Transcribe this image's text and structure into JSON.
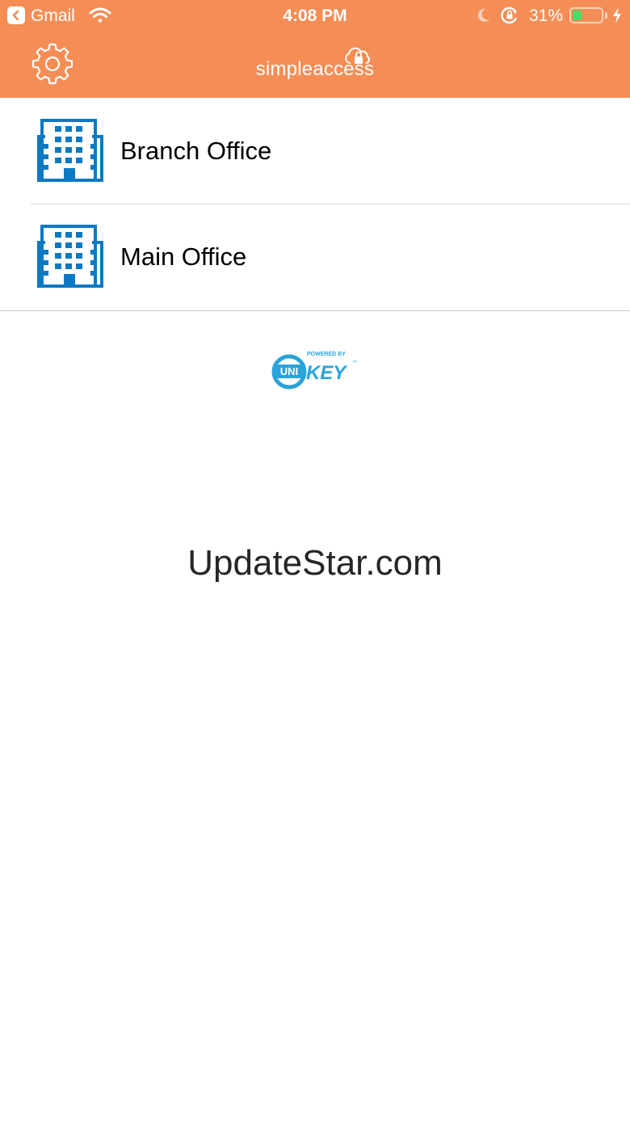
{
  "status_bar": {
    "back_app": "Gmail",
    "time": "4:08 PM",
    "battery": "31%",
    "icons": [
      "back-arrow-icon",
      "wifi-icon",
      "moon-icon",
      "rotation-lock-icon",
      "battery-icon",
      "charging-bolt-icon"
    ]
  },
  "header": {
    "logo_text": "simpleaccess",
    "settings_icon": "gear-icon",
    "background": "#f48e56"
  },
  "sites": [
    {
      "label": "Branch Office",
      "icon": "building-icon"
    },
    {
      "label": "Main Office",
      "icon": "building-icon"
    }
  ],
  "footer_logo": {
    "powered_by": "POWERED BY",
    "uni": "UNI",
    "key": "KEY",
    "tm": "™",
    "color": "#2aa3d9"
  },
  "watermark": "UpdateStar.com",
  "colors": {
    "accent": "#f48e56",
    "building_blue": "#0d79c3"
  }
}
